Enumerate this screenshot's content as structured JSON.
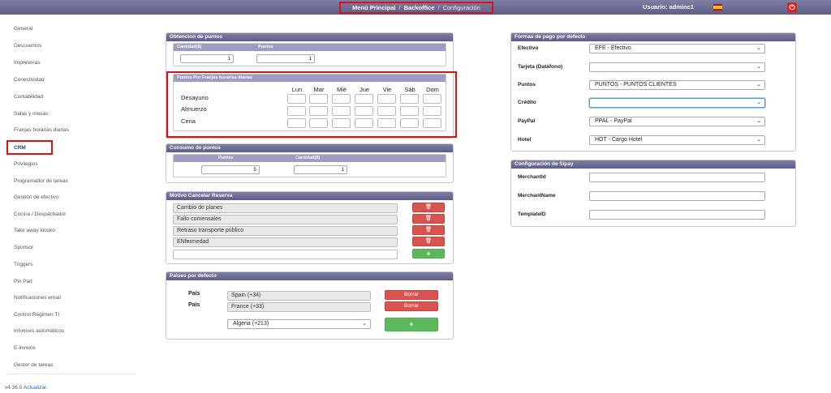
{
  "topbar": {
    "crumb_main": "Menú Principal",
    "crumb_sep1": "/",
    "crumb_backoffice": "Backoffice",
    "crumb_sep2": "/",
    "crumb_current": "Configuración",
    "user_label": "Usuario: adminc1"
  },
  "sidebar": {
    "items": [
      {
        "label": "General"
      },
      {
        "label": "Descuentos"
      },
      {
        "label": "Impresoras"
      },
      {
        "label": "Conectividad"
      },
      {
        "label": "Contabilidad"
      },
      {
        "label": "Salas y mesas"
      },
      {
        "label": "Franjas horarias diarias"
      },
      {
        "label": "CRM"
      },
      {
        "label": "Privilegios"
      },
      {
        "label": "Programador de tareas"
      },
      {
        "label": "Gestión de efectivo"
      },
      {
        "label": "Cocina / Despachador"
      },
      {
        "label": "Take away kiosko"
      },
      {
        "label": "Sponsor"
      },
      {
        "label": "Triggers"
      },
      {
        "label": "Pin Pad"
      },
      {
        "label": "Notificaciones email"
      },
      {
        "label": "Control Régimen TI"
      },
      {
        "label": "Informes automáticos"
      },
      {
        "label": "E-invoice"
      },
      {
        "label": "Gestor de tareas"
      }
    ],
    "active": "CRM",
    "version": "v4.36.0",
    "update_link": "Actualizar",
    "update_suffix": "."
  },
  "obtencion": {
    "title": "Obtencion de puntos",
    "col_cantidad": "Cantidad($)",
    "col_puntos": "Puntos",
    "cantidad_value": "1",
    "puntos_value": "1"
  },
  "franjas": {
    "title": "Puntos Por Franjas horarias diarias",
    "days": [
      "Lun",
      "Mar",
      "Mié",
      "Jue",
      "Vie",
      "Sáb",
      "Dom"
    ],
    "meals": [
      "Desayuno",
      "Almuerzo",
      "Cena"
    ]
  },
  "consumo": {
    "title": "Consumo de puntos",
    "col_puntos": "Puntos",
    "col_cantidad": "Cantidad($)",
    "puntos_value": "5",
    "cantidad_value": "1"
  },
  "motivo": {
    "title": "Motivo Cancelar Reserva",
    "items": [
      "Cambio de planes",
      "Fallo comensales",
      "Retraso transporte público",
      "ENfermedad"
    ],
    "new_value": "",
    "add_label": "+",
    "delete_glyph": "🗑"
  },
  "paises": {
    "title": "Paises por defecto",
    "label": "País",
    "rows": [
      {
        "value": "Spain (+34)",
        "button": "Borrar"
      },
      {
        "value": "France (+33)",
        "button": "Borrar"
      }
    ],
    "select_value": "Algeria (+213)",
    "add_label": "+"
  },
  "formas_pago": {
    "title": "Formas de pago por defecto",
    "rows": [
      {
        "label": "Efectivo",
        "value": "EFE - Efectivo"
      },
      {
        "label": "Tarjeta (Datáfono)",
        "value": ""
      },
      {
        "label": "Puntos",
        "value": "PUNTOS - PUNTOS CLIENTES"
      },
      {
        "label": "Crédito",
        "value": ""
      },
      {
        "label": "PayPal",
        "value": "PPAL - PayPal"
      },
      {
        "label": "Hotel",
        "value": "HOT - Cargo Hotel"
      }
    ]
  },
  "sipay": {
    "title": "Configuración de Sipay",
    "fields": [
      {
        "label": "MerchantId",
        "value": ""
      },
      {
        "label": "MerchantName",
        "value": ""
      },
      {
        "label": "TemplateID",
        "value": ""
      }
    ]
  },
  "icons": {
    "power": "power-icon",
    "flag": "spain-flag-icon",
    "chevron": "chevron-down-icon",
    "trash": "trash-icon"
  },
  "colors": {
    "header": "#6e6e96",
    "danger": "#d9534f",
    "success": "#5cb85c",
    "highlight": "#e01010"
  }
}
